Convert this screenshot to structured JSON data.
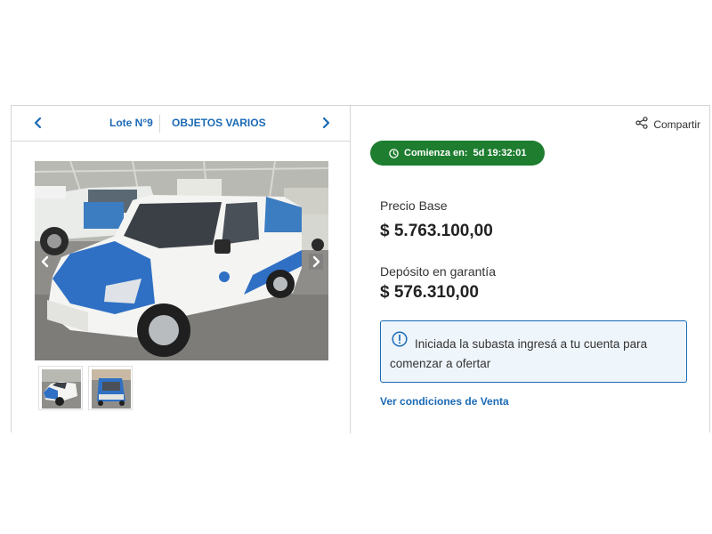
{
  "lot_nav": {
    "lot_number": "Lote N°9",
    "category": "OBJETOS VARIOS"
  },
  "gallery": {
    "thumbnails": [
      "van-front-photo",
      "van-rear-photo"
    ]
  },
  "share": {
    "label": "Compartir"
  },
  "countdown": {
    "label": "Comienza en:",
    "value": "5d 19:32:01",
    "color": "#1e7d2f"
  },
  "pricing": {
    "base_label": "Precio Base",
    "base_value": "$ 5.763.100,00",
    "deposit_label": "Depósito en garantía",
    "deposit_value": "$ 576.310,00"
  },
  "notice": {
    "text": "Iniciada la subasta ingresá a tu cuenta para comenzar a ofertar"
  },
  "conditions_link": "Ver condiciones de Venta",
  "colors": {
    "accent": "#1b6ab5",
    "border": "#d6d6d6",
    "notice_bg": "#eef5fb"
  }
}
